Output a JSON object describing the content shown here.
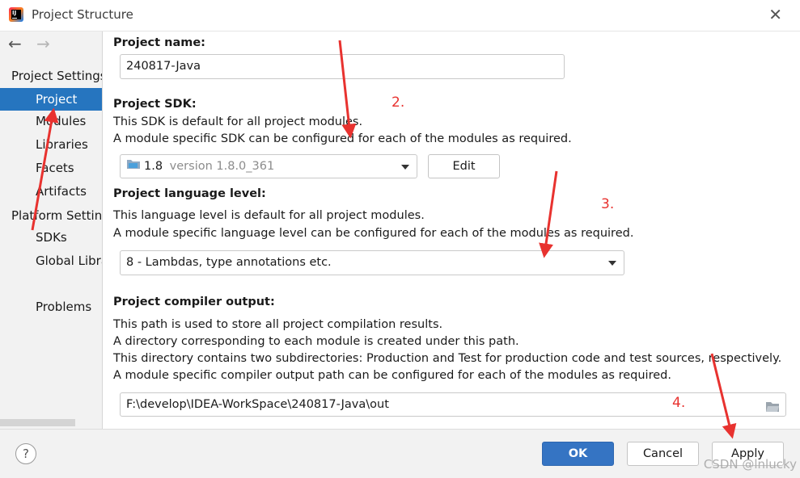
{
  "window": {
    "title": "Project Structure"
  },
  "sidebar": {
    "nav": {
      "back": "←",
      "forward": "→"
    },
    "items": [
      {
        "label": "Project Settings"
      },
      {
        "label": "Project"
      },
      {
        "label": "Modules"
      },
      {
        "label": "Libraries"
      },
      {
        "label": "Facets"
      },
      {
        "label": "Artifacts"
      },
      {
        "label": "Platform Settings"
      },
      {
        "label": "SDKs"
      },
      {
        "label": "Global Libraries"
      },
      {
        "label": "Problems"
      }
    ]
  },
  "main": {
    "project_name": {
      "label": "Project name:",
      "value": "240817-Java"
    },
    "project_sdk": {
      "label": "Project SDK:",
      "desc1": "This SDK is default for all project modules.",
      "desc2": "A module specific SDK can be configured for each of the modules as required.",
      "sdk_name": "1.8",
      "sdk_version": "version 1.8.0_361",
      "edit_label": "Edit"
    },
    "language_level": {
      "label": "Project language level:",
      "desc1": "This language level is default for all project modules.",
      "desc2": "A module specific language level can be configured for each of the modules as required.",
      "value": "8 - Lambdas, type annotations etc."
    },
    "compiler_output": {
      "label": "Project compiler output:",
      "desc1": "This path is used to store all project compilation results.",
      "desc2": "A directory corresponding to each module is created under this path.",
      "desc3": "This directory contains two subdirectories: Production and Test for production code and test sources, respectively.",
      "desc4": "A module specific compiler output path can be configured for each of the modules as required.",
      "value": "F:\\develop\\IDEA-WorkSpace\\240817-Java\\out"
    }
  },
  "footer": {
    "help": "?",
    "ok": "OK",
    "cancel": "Cancel",
    "apply": "Apply"
  },
  "annotations": {
    "n2": "2.",
    "n3": "3.",
    "n4": "4."
  },
  "watermark": "CSDN @lnlucky",
  "colors": {
    "selection": "#2675bf",
    "ok_button": "#3574c3",
    "annotation": "#e8322f"
  }
}
